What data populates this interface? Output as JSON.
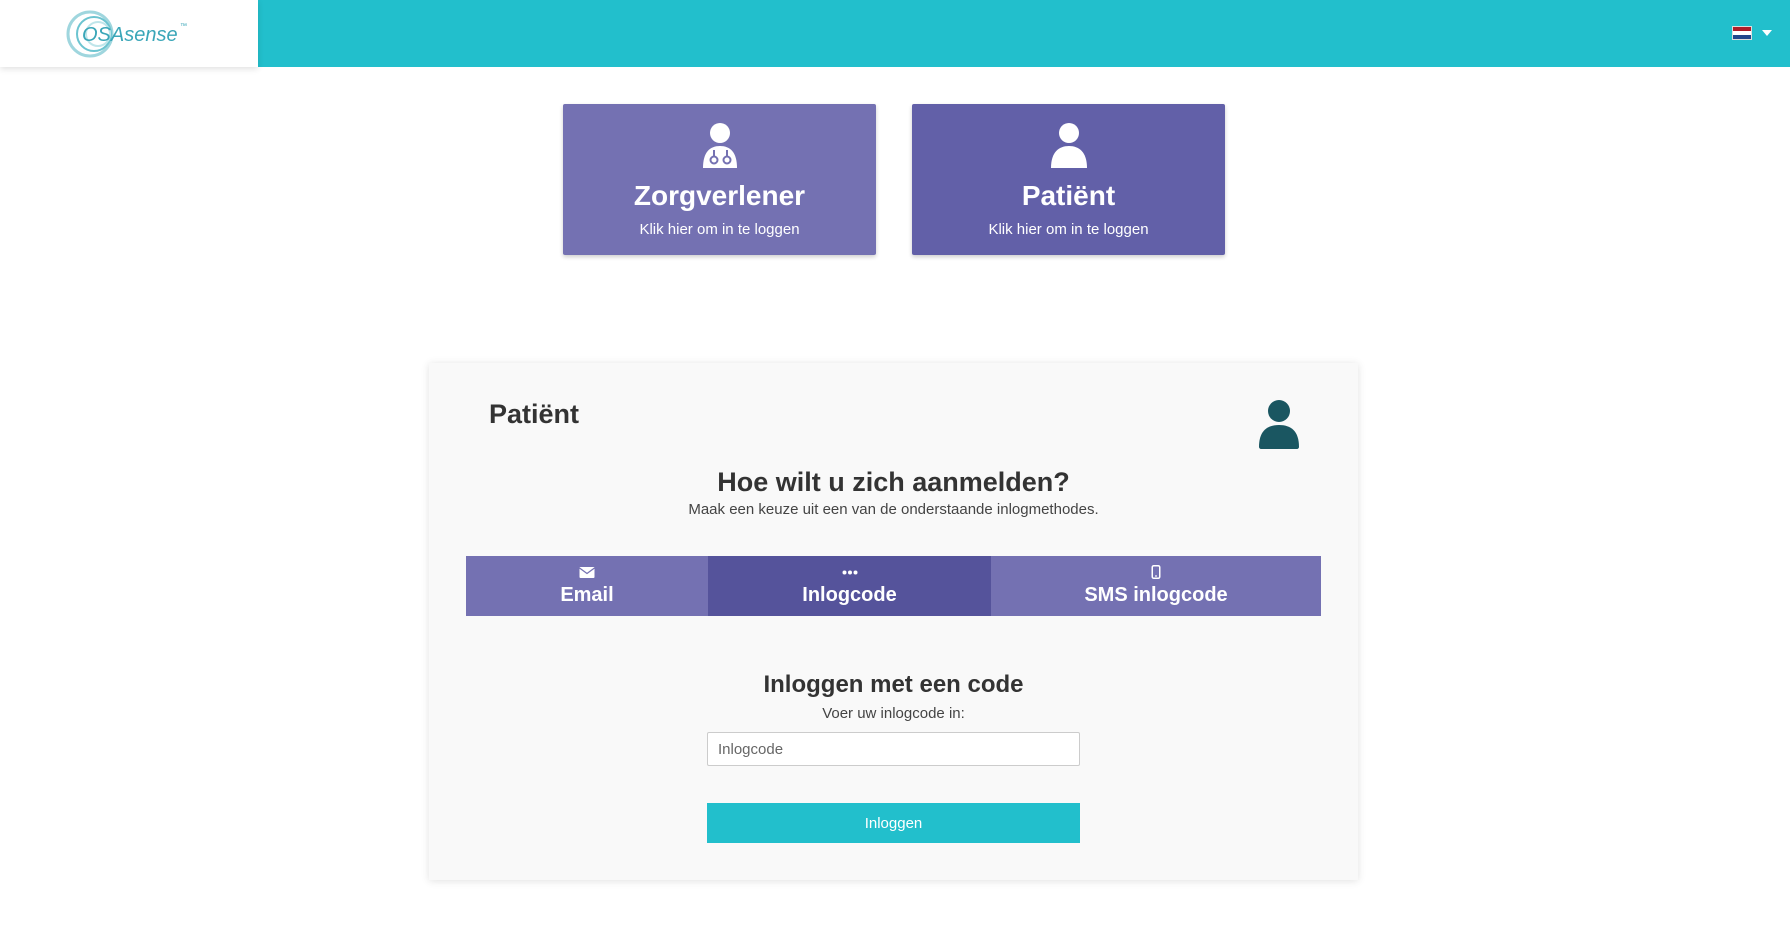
{
  "header": {
    "logo": {
      "brand": "OSAsense",
      "trademark": "™"
    },
    "language": {
      "icon": "flag-nl-icon",
      "flag_colors": [
        "#ae1c28",
        "#ffffff",
        "#21468b"
      ]
    }
  },
  "roles": [
    {
      "icon": "user-md-icon",
      "title": "Zorgverlener",
      "subtitle": "Klik hier om in te loggen"
    },
    {
      "icon": "user-icon",
      "title": "Patiënt",
      "subtitle": "Klik hier om in te loggen"
    }
  ],
  "panel": {
    "title": "Patiënt",
    "icon": "user-icon",
    "question": "Hoe wilt u zich aanmelden?",
    "hint": "Maak een keuze uit een van de onderstaande inlogmethodes.",
    "tabs": [
      {
        "icon": "envelope-icon",
        "label": "Email",
        "active": false
      },
      {
        "icon": "ellipsis-icon",
        "label": "Inlogcode",
        "active": true
      },
      {
        "icon": "mobile-icon",
        "label": "SMS inlogcode",
        "active": false
      }
    ],
    "code_form": {
      "title": "Inloggen met een code",
      "label": "Voer uw inlogcode in:",
      "input_value": "",
      "input_placeholder": "Inlogcode",
      "submit_label": "Inloggen"
    }
  },
  "colors": {
    "accent": "#22bfcc",
    "role_card_light": "#7471b2",
    "role_card_dark": "#6260a8",
    "tab_active": "#55539b",
    "avatar": "#1a5661"
  }
}
